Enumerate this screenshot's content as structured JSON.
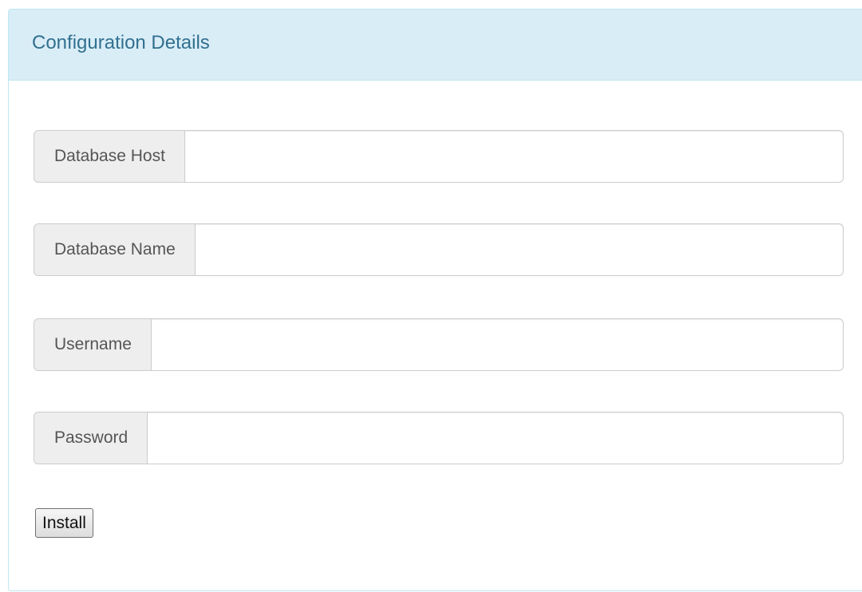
{
  "panel": {
    "title": "Configuration Details"
  },
  "form": {
    "fields": [
      {
        "label": "Database Host",
        "value": "",
        "placeholder": ""
      },
      {
        "label": "Database Name",
        "value": "",
        "placeholder": ""
      },
      {
        "label": "Username",
        "value": "",
        "placeholder": ""
      },
      {
        "label": "Password",
        "value": "",
        "placeholder": ""
      }
    ],
    "submit_label": "Install"
  },
  "colors": {
    "heading_bg": "#d9edf7",
    "heading_text": "#31708f",
    "panel_border": "#bce8f1",
    "addon_bg": "#eeeeee",
    "input_border": "#cccccc"
  }
}
